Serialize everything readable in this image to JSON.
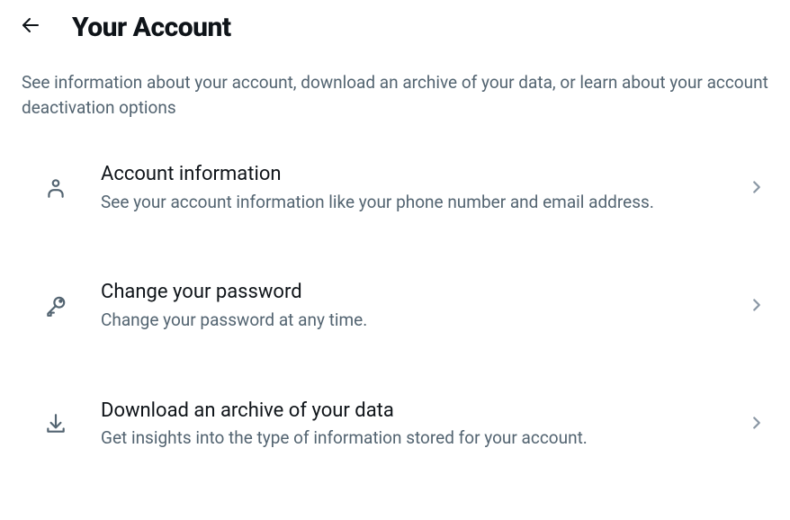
{
  "header": {
    "title": "Your Account"
  },
  "subtitle": "See information about your account, download an archive of your data, or learn about your account deactivation options",
  "menu": [
    {
      "title": "Account information",
      "description": "See your account information like your phone number and email address."
    },
    {
      "title": "Change your password",
      "description": "Change your password at any time."
    },
    {
      "title": "Download an archive of your data",
      "description": "Get insights into the type of information stored for your account."
    }
  ]
}
